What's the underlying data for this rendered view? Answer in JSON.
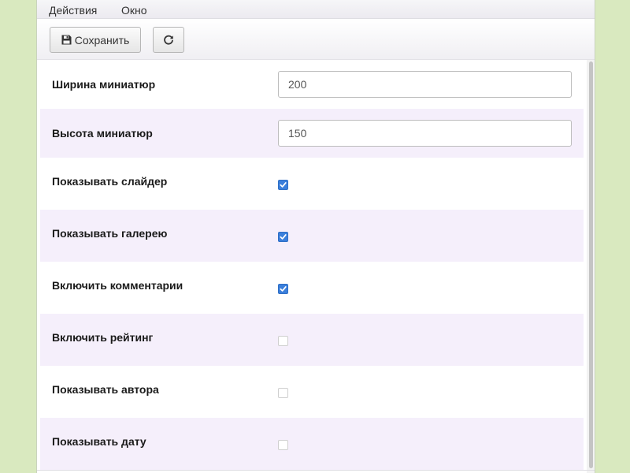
{
  "menubar": {
    "items": [
      {
        "label": "Действия"
      },
      {
        "label": "Окно"
      }
    ]
  },
  "toolbar": {
    "save_label": "Сохранить",
    "save_icon": "floppy-disk-icon",
    "refresh_icon": "refresh-icon"
  },
  "settings": {
    "fields": [
      {
        "label": "Ширина миниатюр",
        "value": "200"
      },
      {
        "label": "Высота миниатюр",
        "value": "150"
      }
    ],
    "checkboxes": [
      {
        "label": "Показывать слайдер",
        "checked": true
      },
      {
        "label": "Показывать галерею",
        "checked": true
      },
      {
        "label": "Включить комментарии",
        "checked": true
      },
      {
        "label": "Включить рейтинг",
        "checked": false
      },
      {
        "label": "Показывать автора",
        "checked": false
      },
      {
        "label": "Показывать дату",
        "checked": false
      }
    ]
  },
  "colors": {
    "background": "#d9e9bf",
    "row_alt": "#f5effb",
    "checkbox_on": "#3b7fdb"
  }
}
